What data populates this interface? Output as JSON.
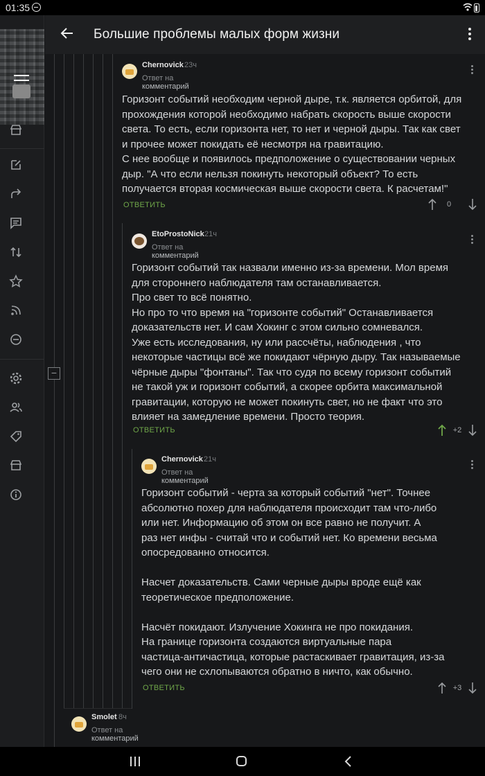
{
  "status_bar": {
    "time": "01:35"
  },
  "header": {
    "title": "Большие проблемы малых форм жизни"
  },
  "sidebar": {
    "icons": [
      "menu-icon",
      "store-icon",
      "edit-icon",
      "share-icon",
      "comments-icon",
      "sort-icon",
      "star-icon",
      "rss-icon",
      "block-icon",
      "settings-icon",
      "users-icon",
      "tag-icon",
      "shop-icon",
      "info-icon"
    ]
  },
  "comments": [
    {
      "author": "Chernovick",
      "time": "23ч",
      "reply_prefix": "Ответ на",
      "reply_target": "комментарий",
      "paragraphs": [
        "Горизонт событий необходим черной дыре, т.к. является орбитой, для",
        "прохождения которой необходимо набрать скорость выше скорости",
        "света. То есть, если горизонта нет, то нет и черной дыры. Так как свет",
        "и прочее может покидать её несмотря на гравитацию.",
        "С нее вообще и появилось предположение о существовании черных",
        "дыр. \"А что если нельзя покинуть некоторый объект? То есть",
        "получается вторая космическая выше скорости света. К расчетам!\""
      ],
      "reply_label": "ОТВЕТИТЬ",
      "score": "0"
    },
    {
      "author": "EtoProstoNick",
      "time": "21ч",
      "reply_prefix": "Ответ на",
      "reply_target": "комментарий",
      "paragraphs": [
        "Горизонт событий так назвали именно из-за времени. Мол время",
        "для стороннего наблюдателя там останавливается.",
        "Про свет то всё понятно.",
        "Но про то что время на \"горизонте событий\" Останавливается",
        "доказательств нет. И сам Хокинг с этом сильно сомневался.",
        "Уже есть исследования, ну или рассчёты, наблюдения , что",
        "некоторые частицы всё же покидают чёрную дыру. Так называемые",
        "чёрные дыры \"фонтаны\". Так что судя по всему горизонт событий",
        "не такой уж и горизонт событий, а скорее орбита максимальной",
        "гравитации, которую не может покинуть свет, но не факт что это",
        "влияет на замедление времени. Просто теория."
      ],
      "reply_label": "ОТВЕТИТЬ",
      "score": "+2"
    },
    {
      "author": "Chernovick",
      "time": "21ч",
      "reply_prefix": "Ответ на",
      "reply_target": "комментарий",
      "paragraphs": [
        "Горизонт событий - черта за который событий \"нет\". Точнее",
        "абсолютно похер для наблюдателя происходит там что-либо",
        "или нет. Информацию об этом он все равно не получит. А",
        "раз нет инфы - считай что и событий нет. Ко времени весьма",
        "опосредованно относится.",
        "",
        "Насчет доказательств. Сами черные дыры вроде ещё как",
        "теоретическое предположение.",
        "",
        "Насчёт покидают. Излучение Хокинга не про покидания.",
        "На границе горизонта создаются виртуальные пара",
        "частица-античастица, которые растаскивает гравитация, из-за",
        "чего они не схлопываются обратно в ничто, как обычно."
      ],
      "reply_label": "ОТВЕТИТЬ",
      "score": "+3"
    },
    {
      "author": "Smolet",
      "time": "8ч",
      "reply_prefix": "Ответ на",
      "reply_target": "комментарий"
    }
  ],
  "colors": {
    "accent_green": "#6fa649",
    "background": "#17181a"
  }
}
